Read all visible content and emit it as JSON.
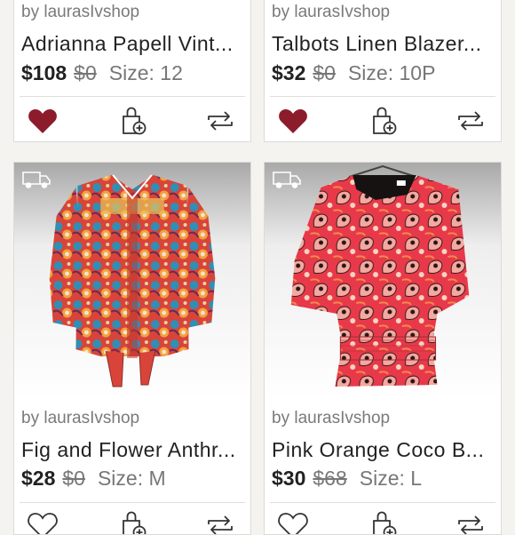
{
  "listings": [
    {
      "seller": "by laurasIvshop",
      "title": "Adrianna Papell Vint...",
      "price": "$108",
      "original_price": "$0",
      "size": "Size: 12",
      "liked": true
    },
    {
      "seller": "by laurasIvshop",
      "title": "Talbots Linen Blazer...",
      "price": "$32",
      "original_price": "$0",
      "size": "Size: 10P",
      "liked": true
    },
    {
      "seller": "by laurasIvshop",
      "title": "Fig and Flower Anthr...",
      "price": "$28",
      "original_price": "$0",
      "size": "Size: M",
      "photo": "paisley-button-front-blouse",
      "badge_icon": "truck-icon"
    },
    {
      "seller": "by laurasIvshop",
      "title": "Pink Orange Coco B...",
      "price": "$30",
      "original_price": "$68",
      "size": "Size: L",
      "photo": "pink-paisley-kimono-top",
      "badge_icon": "truck-icon"
    }
  ],
  "colors": {
    "heart": "#8c1c2c",
    "background": "#f4f3f0"
  },
  "icons": [
    "heart-icon",
    "bundle-bag-icon",
    "share-icon",
    "truck-icon"
  ]
}
